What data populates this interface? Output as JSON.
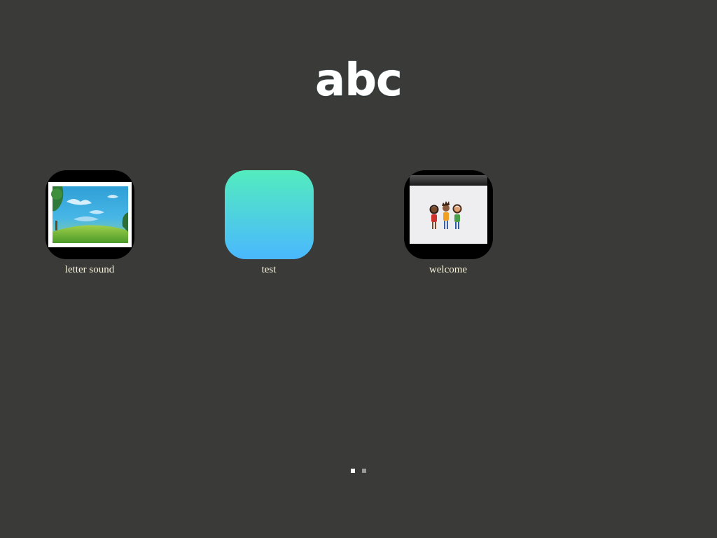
{
  "header": {
    "logo_text": "abc"
  },
  "apps": [
    {
      "label": "letter sound",
      "icon": "landscape-thumbnail-icon"
    },
    {
      "label": "test",
      "icon": "gradient-app-icon"
    },
    {
      "label": "welcome",
      "icon": "children-thumbnail-icon"
    }
  ],
  "pager": {
    "pages": 2,
    "current": 1,
    "active_color": "#ffffff",
    "inactive_color": "#9a9a9a"
  },
  "colors": {
    "background": "#3a3b39",
    "label": "#f6f1da",
    "gradient_top": "#53ecbe",
    "gradient_bottom": "#4ab8fe"
  }
}
